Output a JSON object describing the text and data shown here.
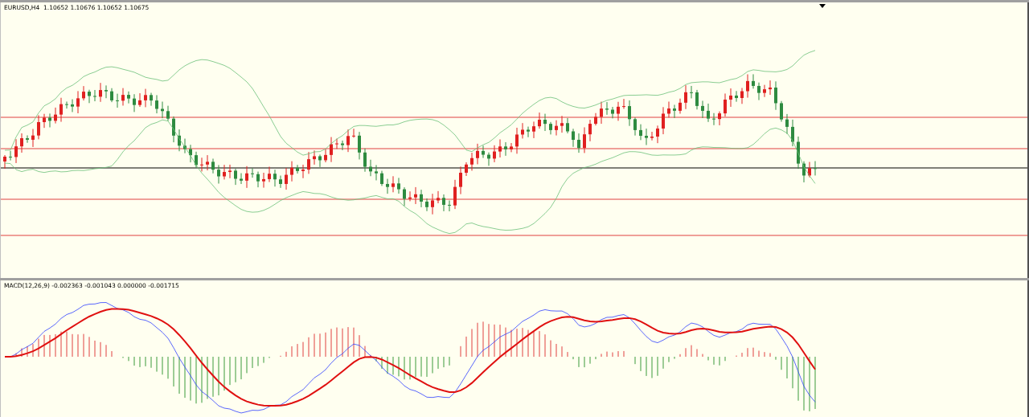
{
  "price_panel": {
    "label": "EURUSD,H4  1.10652 1.10676 1.10652 1.10675"
  },
  "macd_panel": {
    "label": "MACD(12,26,9) -0.002363 -0.001043 0.000000 -0.001715"
  }
}
